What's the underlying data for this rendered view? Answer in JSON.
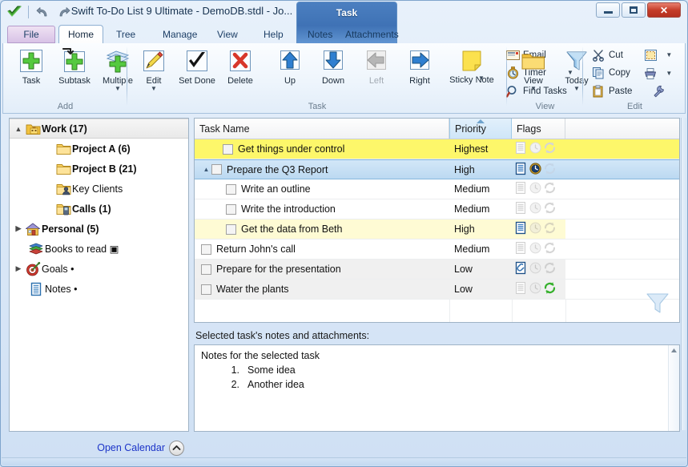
{
  "window": {
    "title": "Swift To-Do List 9 Ultimate - DemoDB.stdl - Jo...",
    "minimize_label": "",
    "maximize_label": "",
    "close_label": "✕"
  },
  "quick_access": {
    "app_icon": "green-check-icon",
    "undo_label": "↶",
    "redo_label": "↷"
  },
  "contextual_tab_group": {
    "label": "Task"
  },
  "tabs": [
    {
      "label": "File",
      "name": "tab-file"
    },
    {
      "label": "Home",
      "name": "tab-home"
    },
    {
      "label": "Tree",
      "name": "tab-tree"
    },
    {
      "label": "Manage",
      "name": "tab-manage"
    },
    {
      "label": "View",
      "name": "tab-view"
    },
    {
      "label": "Help",
      "name": "tab-help"
    },
    {
      "label": "Notes",
      "name": "tab-notes"
    },
    {
      "label": "Attachments",
      "name": "tab-attachments"
    }
  ],
  "ribbon": {
    "collapse_glyph": "⌃",
    "groups": [
      {
        "label": "Add",
        "buttons": [
          {
            "label": "Task",
            "icon": "add-task-icon"
          },
          {
            "label": "Subtask",
            "icon": "add-subtask-icon"
          },
          {
            "label": "Multiple",
            "icon": "add-multiple-icon",
            "caret": "▼"
          }
        ]
      },
      {
        "label": "Task",
        "buttons": [
          {
            "label": "Edit",
            "icon": "edit-pencil-icon",
            "caret": "▼"
          },
          {
            "label": "Set Done",
            "icon": "checkmark-icon"
          },
          {
            "label": "Delete",
            "icon": "delete-x-icon"
          },
          {
            "label": "Up",
            "icon": "arrow-up-icon"
          },
          {
            "label": "Down",
            "icon": "arrow-down-icon"
          },
          {
            "label": "Left",
            "icon": "arrow-left-icon",
            "disabled": true
          },
          {
            "label": "Right",
            "icon": "arrow-right-icon"
          },
          {
            "label": "Sticky Note",
            "icon": "sticky-note-icon",
            "caret": "▼"
          }
        ],
        "small_buttons": [
          {
            "label": "Email",
            "icon": "email-icon"
          },
          {
            "label": "Timer",
            "icon": "timer-icon",
            "caret": "▼"
          },
          {
            "label": "Find Tasks",
            "icon": "magnifier-icon"
          }
        ]
      },
      {
        "label": "View",
        "buttons": [
          {
            "label": "View",
            "icon": "folder-icon",
            "caret": "▼"
          },
          {
            "label": "Today",
            "icon": "funnel-icon",
            "caret": "▼"
          }
        ]
      },
      {
        "label": "Edit",
        "small_buttons": [
          {
            "label": "Cut",
            "icon": "scissors-icon"
          },
          {
            "label": "Copy",
            "icon": "copy-icon"
          },
          {
            "label": "Paste",
            "icon": "clipboard-paste-icon"
          }
        ],
        "icon_buttons": [
          {
            "label": "",
            "icon": "select-all-icon",
            "caret": "▼"
          },
          {
            "label": "",
            "icon": "printer-icon",
            "caret": "▼"
          },
          {
            "label": "",
            "icon": "wrench-icon"
          }
        ]
      }
    ]
  },
  "tree": {
    "items": [
      {
        "label": "Work (17)",
        "icon": "work-folder-icon",
        "level": 0,
        "expander": "▲",
        "bold": true,
        "selected": true
      },
      {
        "label": "Project A (6)",
        "icon": "folder-icon",
        "level": 2,
        "expander": "",
        "bold": true,
        "selected": false
      },
      {
        "label": "Project B (21)",
        "icon": "folder-icon",
        "level": 2,
        "expander": "",
        "bold": true,
        "selected": false
      },
      {
        "label": "Key Clients",
        "icon": "clients-folder-icon",
        "level": 2,
        "expander": "",
        "bold": false,
        "selected": false
      },
      {
        "label": "Calls (1)",
        "icon": "calls-folder-icon",
        "level": 2,
        "expander": "",
        "bold": true,
        "selected": false
      },
      {
        "label": "Personal (5)",
        "icon": "house-icon",
        "level": 0,
        "expander": "▶",
        "bold": true,
        "selected": false
      },
      {
        "label": "Books to read ▣",
        "icon": "books-icon",
        "level": 1,
        "expander": "",
        "bold": false,
        "selected": false
      },
      {
        "label": "Goals •",
        "icon": "target-icon",
        "level": 0,
        "expander": "▶",
        "bold": false,
        "selected": false
      },
      {
        "label": "Notes •",
        "icon": "notes-list-icon",
        "level": 1,
        "expander": "",
        "bold": false,
        "selected": false
      }
    ],
    "open_calendar_label": "Open Calendar",
    "collapse_glyph": "⌃"
  },
  "grid": {
    "columns": [
      {
        "label": "Task Name",
        "name": "column-task-name",
        "sorted": false
      },
      {
        "label": "Priority",
        "name": "column-priority",
        "sorted": true
      },
      {
        "label": "Flags",
        "name": "column-flags",
        "sorted": false
      }
    ],
    "rows": [
      {
        "name": "Get things under control",
        "priority": "Highest",
        "indent": 1,
        "expander": "",
        "highlight": "yellow",
        "flags": {
          "notes": "off",
          "reminder": "off",
          "recurring": "off"
        }
      },
      {
        "name": "Prepare the Q3 Report",
        "priority": "High",
        "indent": 1,
        "expander": "▲",
        "highlight": "selected",
        "flags": {
          "notes": "on",
          "reminder": "on",
          "recurring": "off"
        }
      },
      {
        "name": "Write an outline",
        "priority": "Medium",
        "indent": 2,
        "expander": "",
        "highlight": "none",
        "flags": {
          "notes": "off",
          "reminder": "off",
          "recurring": "off"
        }
      },
      {
        "name": "Write the introduction",
        "priority": "Medium",
        "indent": 2,
        "expander": "",
        "highlight": "none",
        "flags": {
          "notes": "off",
          "reminder": "off",
          "recurring": "off"
        }
      },
      {
        "name": "Get the data from Beth",
        "priority": "High",
        "indent": 2,
        "expander": "",
        "highlight": "lightyellow",
        "flags": {
          "notes": "on",
          "reminder": "off",
          "recurring": "off"
        }
      },
      {
        "name": "Return John's call",
        "priority": "Medium",
        "indent": 0,
        "expander": "",
        "highlight": "none",
        "flags": {
          "notes": "off",
          "reminder": "off",
          "recurring": "off"
        }
      },
      {
        "name": "Prepare for the presentation",
        "priority": "Low",
        "indent": 0,
        "expander": "",
        "highlight": "alt",
        "flags": {
          "notes": "attachment",
          "reminder": "off",
          "recurring": "off"
        }
      },
      {
        "name": "Water the plants",
        "priority": "Low",
        "indent": 0,
        "expander": "",
        "highlight": "alt",
        "flags": {
          "notes": "off",
          "reminder": "off",
          "recurring": "on"
        }
      }
    ],
    "filter_icon": "funnel-icon"
  },
  "notes": {
    "caption": "Selected task's notes and attachments:",
    "title": "Notes for the selected task",
    "items": [
      {
        "num": "1.",
        "text": "Some idea"
      },
      {
        "num": "2.",
        "text": "Another idea"
      }
    ],
    "scroll_up_glyph": "▲"
  },
  "colors": {
    "accent_blue": "#3f72b5",
    "highlight_yellow": "#fdf76a",
    "light_yellow": "#fefbd4",
    "selection_blue": "#bcd9f1",
    "link_blue": "#1c34c8",
    "close_red": "#c43c28",
    "green": "#3aa32e",
    "folder_yellow": "#f5c842"
  }
}
